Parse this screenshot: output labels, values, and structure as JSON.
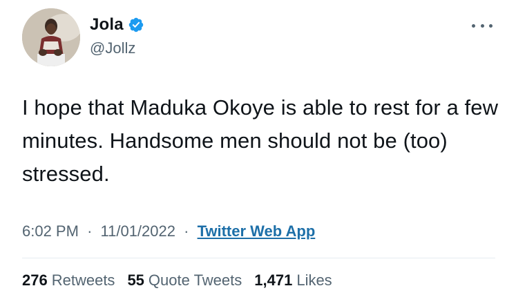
{
  "author": {
    "display_name": "Jola",
    "handle": "@Jollz",
    "verified": true,
    "verified_color": "#1d9bf0"
  },
  "tweet": {
    "text": "I hope that Maduka Okoye is able to rest for a few minutes. Handsome men should not be (too) stressed.",
    "time": "6:02 PM",
    "date": "11/01/2022",
    "separator": "·",
    "source": "Twitter Web App"
  },
  "stats": {
    "retweets_count": "276",
    "retweets_label": "Retweets",
    "quotes_count": "55",
    "quotes_label": "Quote Tweets",
    "likes_count": "1,471",
    "likes_label": "Likes"
  },
  "icons": {
    "more": "more-horizontal-icon",
    "verified": "verified-badge-icon"
  }
}
